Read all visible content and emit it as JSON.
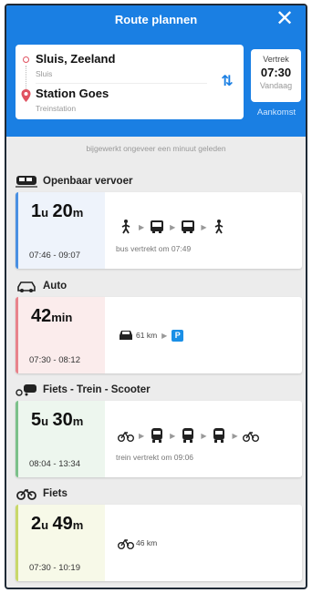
{
  "header": {
    "title": "Route plannen",
    "close_icon": "close-icon"
  },
  "route": {
    "origin_name": "Sluis, Zeeland",
    "origin_sub": "Sluis",
    "destination_name": "Station Goes",
    "destination_sub": "Treinstation"
  },
  "time": {
    "label": "Vertrek",
    "value": "07:30",
    "day": "Vandaag",
    "arrival_link": "Aankomst"
  },
  "updated_text": "bijgewerkt ongeveer een minuut geleden",
  "colors": {
    "header": "#1a7fe3",
    "ov": "#4a90e2",
    "auto": "#e8838b",
    "fiets_trein": "#7cc08a",
    "fiets": "#c9d86a"
  },
  "options": [
    {
      "section": "Openbaar vervoer",
      "section_icon": "train-icon",
      "dur_h": "1",
      "dur_h_unit": "u",
      "dur_m": "20",
      "dur_m_unit": "m",
      "times": "07:46 - 09:07",
      "legs": [
        "walk-icon",
        "bus-icon",
        "bus-icon",
        "walk-icon"
      ],
      "note": "bus vertrekt om 07:49"
    },
    {
      "section": "Auto",
      "section_icon": "car-icon",
      "dur_h": "42",
      "dur_h_unit": "min",
      "dur_m": "",
      "dur_m_unit": "",
      "times": "07:30 - 08:12",
      "legs": [
        "car-icon",
        "parking-icon"
      ],
      "leg_text": "61 km",
      "parking_label": "P",
      "note": ""
    },
    {
      "section": "Fiets - Trein - Scooter",
      "section_icon": "bike-train-icon",
      "dur_h": "5",
      "dur_h_unit": "u",
      "dur_m": "30",
      "dur_m_unit": "m",
      "times": "08:04 - 13:34",
      "legs": [
        "bike-icon",
        "train-icon",
        "train-icon",
        "train-icon",
        "bike-icon"
      ],
      "note": "trein vertrekt om 09:06"
    },
    {
      "section": "Fiets",
      "section_icon": "bike-icon",
      "dur_h": "2",
      "dur_h_unit": "u",
      "dur_m": "49",
      "dur_m_unit": "m",
      "times": "07:30 - 10:19",
      "legs": [
        "bike-icon"
      ],
      "leg_text": "46 km",
      "note": ""
    }
  ]
}
